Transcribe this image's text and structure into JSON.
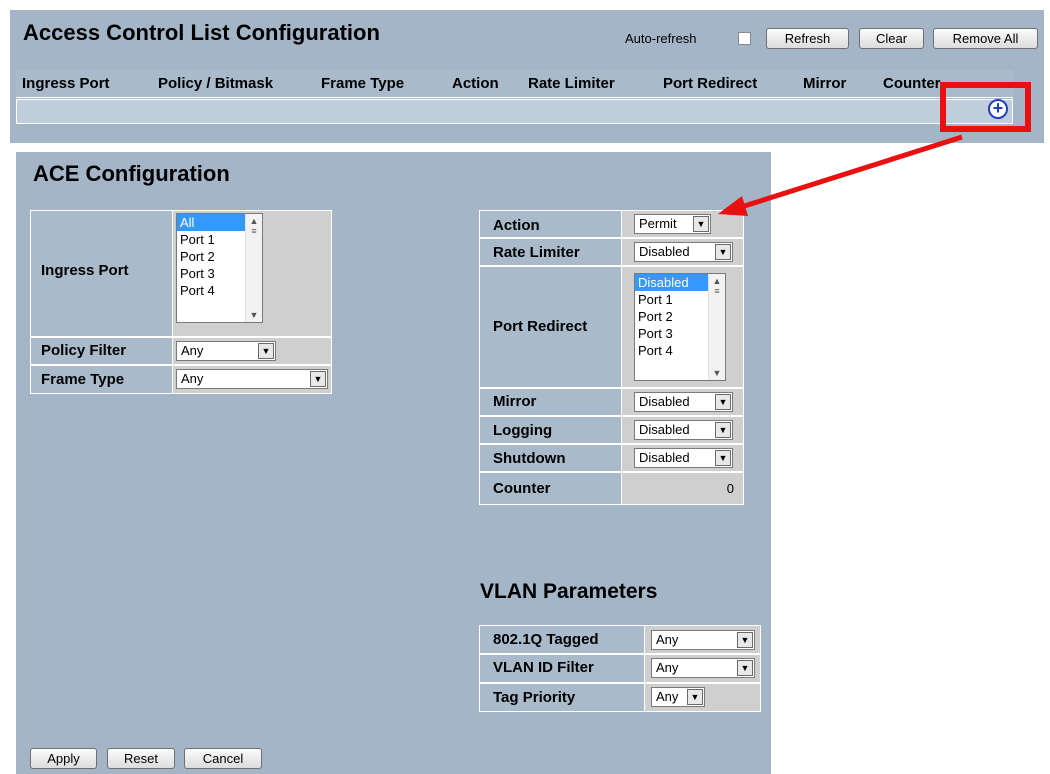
{
  "acl": {
    "title": "Access Control List Configuration",
    "auto_refresh_label": "Auto-refresh",
    "auto_refresh_checked": false,
    "buttons": {
      "refresh": "Refresh",
      "clear": "Clear",
      "remove_all": "Remove All"
    },
    "columns": [
      "Ingress Port",
      "Policy / Bitmask",
      "Frame Type",
      "Action",
      "Rate Limiter",
      "Port Redirect",
      "Mirror",
      "Counter"
    ],
    "add_icon": "plus-circle-icon",
    "highlight_color": "#e8110f"
  },
  "ace": {
    "title": "ACE Configuration",
    "ingress_port": {
      "label": "Ingress Port",
      "options": [
        "All",
        "Port 1",
        "Port 2",
        "Port 3",
        "Port 4"
      ],
      "selected": "All"
    },
    "policy_filter": {
      "label": "Policy Filter",
      "value": "Any"
    },
    "frame_type": {
      "label": "Frame Type",
      "value": "Any"
    },
    "action": {
      "label": "Action",
      "value": "Permit"
    },
    "rate_limiter": {
      "label": "Rate Limiter",
      "value": "Disabled"
    },
    "port_redirect": {
      "label": "Port Redirect",
      "options": [
        "Disabled",
        "Port 1",
        "Port 2",
        "Port 3",
        "Port 4"
      ],
      "selected": "Disabled"
    },
    "mirror": {
      "label": "Mirror",
      "value": "Disabled"
    },
    "logging": {
      "label": "Logging",
      "value": "Disabled"
    },
    "shutdown": {
      "label": "Shutdown",
      "value": "Disabled"
    },
    "counter": {
      "label": "Counter",
      "value": "0"
    }
  },
  "vlan": {
    "title": "VLAN Parameters",
    "tagged": {
      "label": "802.1Q Tagged",
      "value": "Any"
    },
    "vlan_id_filter": {
      "label": "VLAN ID Filter",
      "value": "Any"
    },
    "tag_priority": {
      "label": "Tag Priority",
      "value": "Any"
    }
  },
  "form_buttons": {
    "apply": "Apply",
    "reset": "Reset",
    "cancel": "Cancel"
  },
  "colors": {
    "panel": "#a4b5c7",
    "header": "#a9bacb",
    "arrow": "#e8110f",
    "selected": "#3399ff"
  }
}
